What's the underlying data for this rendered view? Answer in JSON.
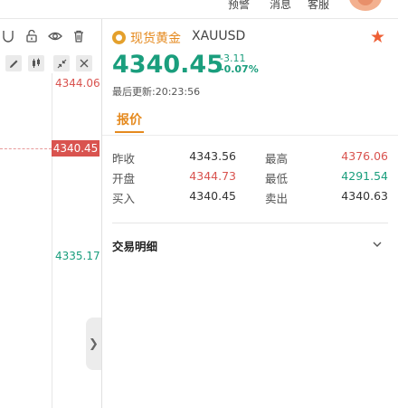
{
  "topbar": {
    "nav": [
      "预警",
      "消息",
      "客服"
    ]
  },
  "chart": {
    "axis_high": "4344.06",
    "axis_current": "4340.45",
    "axis_low": "4335.17"
  },
  "quote": {
    "product_name": "现货黄金",
    "symbol": "XAUUSD",
    "last_price": "4340.45",
    "change_abs": "-3.11",
    "change_pct": "-0.07%",
    "update_time": "最后更新:20:23:56",
    "tab_label": "报价",
    "rows": [
      {
        "label": "昨收",
        "value": "4343.56",
        "label2": "最高",
        "value2": "4376.06"
      },
      {
        "label": "开盘",
        "value": "4344.73",
        "label2": "最低",
        "value2": "4291.54"
      },
      {
        "label": "买入",
        "value": "4340.45",
        "label2": "卖出",
        "value2": "4340.63"
      }
    ],
    "detail_label": "交易明细"
  },
  "colors": {
    "up": "#d9534f",
    "down": "#1a9e7d",
    "accent": "#e58a1f",
    "favorite": "#ee5f35"
  },
  "icons": {
    "favorite": "star-icon",
    "product": "gold-coin-icon",
    "chevron": "chevron-down-icon",
    "collapse": "chevron-right-icon"
  }
}
